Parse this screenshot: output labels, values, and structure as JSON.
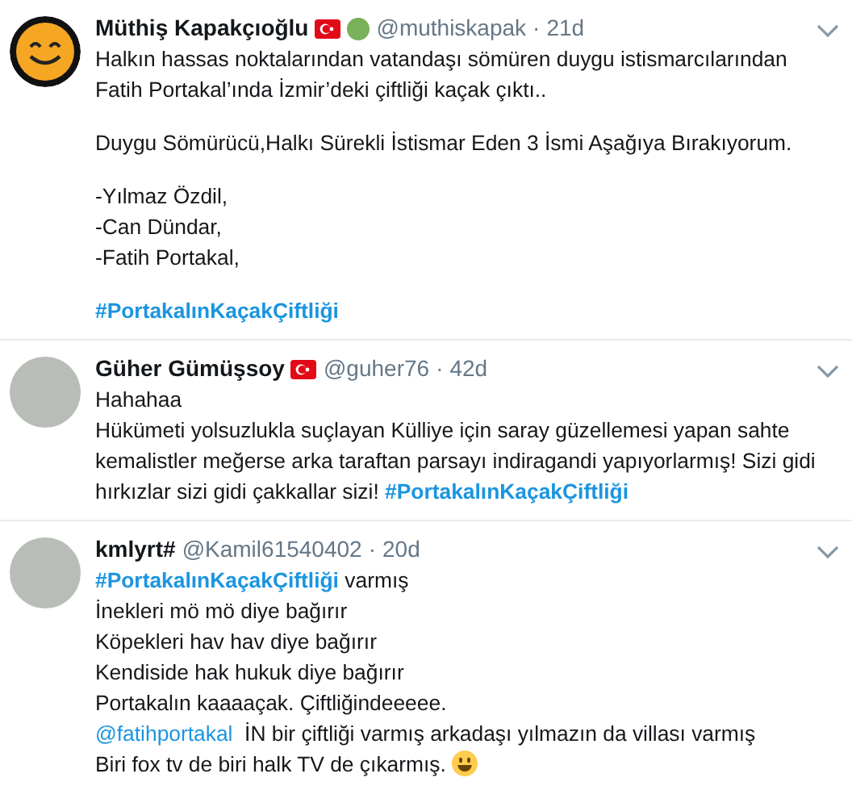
{
  "tweets": [
    {
      "avatar": {
        "kind": "smiley"
      },
      "name": "Müthiş Kapakçıoğlu",
      "badges": [
        {
          "kind": "flag"
        },
        {
          "kind": "dot"
        }
      ],
      "handle": "@muthiskapak",
      "separator": "·",
      "time": "21d",
      "paragraphs": [
        [
          [
            {
              "kind": "text",
              "text": "Halkın hassas noktalarından vatandaşı sömüren duygu istismarcılarından"
            }
          ],
          [
            {
              "kind": "text",
              "text": "Fatih Portakal’ında İzmir’deki çiftliği kaçak çıktı.."
            }
          ]
        ],
        [
          [
            {
              "kind": "text",
              "text": "Duygu Sömürücü,Halkı Sürekli İstismar Eden 3 İsmi Aşağıya Bırakıyorum."
            }
          ]
        ],
        [
          [
            {
              "kind": "text",
              "text": "-Yılmaz Özdil,"
            }
          ],
          [
            {
              "kind": "text",
              "text": "-Can Dündar,"
            }
          ],
          [
            {
              "kind": "text",
              "text": "-Fatih Portakal,"
            }
          ]
        ],
        [
          [
            {
              "kind": "hashtag",
              "text": "#PortakalınKaçakÇiftliği"
            }
          ]
        ]
      ]
    },
    {
      "avatar": {
        "kind": "photo"
      },
      "name": "Güher Gümüşsoy",
      "badges": [
        {
          "kind": "flag"
        }
      ],
      "handle": "@guher76",
      "separator": "·",
      "time": "42d",
      "paragraphs": [
        [
          [
            {
              "kind": "text",
              "text": "Hahahaa"
            }
          ],
          [
            {
              "kind": "text",
              "text": "Hükümeti yolsuzlukla suçlayan Külliye için saray güzellemesi yapan sahte"
            }
          ],
          [
            {
              "kind": "text",
              "text": "kemalistler meğerse arka taraftan parsayı indiragandi yapıyorlarmış! Sizi gidi"
            }
          ],
          [
            {
              "kind": "text",
              "text": "hırkızlar sizi gidi çakkallar sizi! "
            },
            {
              "kind": "hashtag",
              "text": "#PortakalınKaçakÇiftliği"
            }
          ]
        ]
      ]
    },
    {
      "avatar": {
        "kind": "photo"
      },
      "name": "kmlyrt#",
      "handle": "@Kamil61540402",
      "separator": "·",
      "time": "20d",
      "paragraphs": [
        [
          [
            {
              "kind": "hashtag",
              "text": "#PortakalınKaçakÇiftliği"
            },
            {
              "kind": "text",
              "text": " varmış"
            }
          ],
          [
            {
              "kind": "text",
              "text": "İnekleri mö mö diye bağırır"
            }
          ],
          [
            {
              "kind": "text",
              "text": "Köpekleri hav hav diye bağırır"
            }
          ],
          [
            {
              "kind": "text",
              "text": "Kendiside hak hukuk diye bağırır"
            }
          ],
          [
            {
              "kind": "text",
              "text": "Portakalın kaaaaçak. Çiftliğindeeeee."
            }
          ],
          [
            {
              "kind": "mention",
              "text": "@fatihportakal"
            },
            {
              "kind": "text",
              "text": "  İN bir çiftliği varmış arkadaşı yılmazın da villası varmış"
            }
          ],
          [
            {
              "kind": "text",
              "text": "Biri fox tv de biri halk TV de çıkarmış. "
            },
            {
              "kind": "emoji"
            }
          ]
        ]
      ]
    }
  ]
}
